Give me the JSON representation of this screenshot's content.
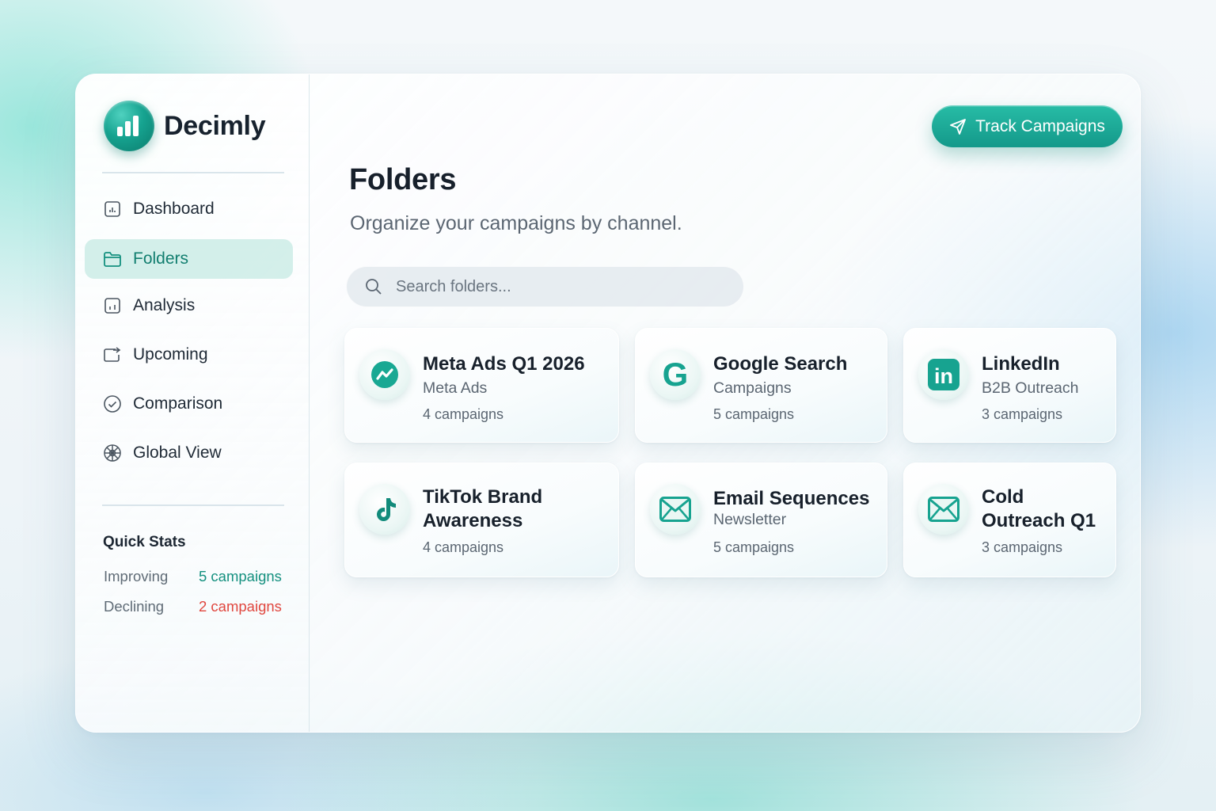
{
  "app": {
    "name": "Decimly",
    "brand_color": "#16a390"
  },
  "sidebar": {
    "items": [
      {
        "label": "Dashboard",
        "icon": "dashboard-icon",
        "active": false
      },
      {
        "label": "Folders",
        "icon": "folder-icon",
        "active": true
      },
      {
        "label": "Analysis",
        "icon": "analysis-icon",
        "active": false
      },
      {
        "label": "Upcoming",
        "icon": "upcoming-icon",
        "active": false
      },
      {
        "label": "Comparison",
        "icon": "check-circle-icon",
        "active": false
      },
      {
        "label": "Global View",
        "icon": "globe-icon",
        "active": false
      }
    ],
    "quick_stats": {
      "title": "Quick Stats",
      "improving_label": "Improving",
      "improving_value": "5 campaigns",
      "improving_color": "#14907f",
      "declining_label": "Declining",
      "declining_value": "2 campaigns",
      "declining_color": "#e0473f"
    }
  },
  "header": {
    "cta_label": "Track Campaigns",
    "cta_icon": "send-icon"
  },
  "main": {
    "title": "Folders",
    "subtitle": "Organize your campaigns by channel.",
    "search_placeholder": "Search folders..."
  },
  "folders": [
    {
      "title": "Meta Ads Q1 2026",
      "subtitle": "Meta Ads",
      "count": "4 campaigns",
      "icon": "meta-trend-icon"
    },
    {
      "title": "Google Search",
      "subtitle": "Campaigns",
      "count": "5 campaigns",
      "icon": "google-icon"
    },
    {
      "title": "LinkedIn",
      "subtitle": "B2B Outreach",
      "count": "3 campaigns",
      "icon": "linkedin-icon"
    },
    {
      "title_line1": "TikTok Brand",
      "title_line2": "Awareness",
      "count": "4 campaigns",
      "icon": "tiktok-icon"
    },
    {
      "title": "Email Sequences",
      "subtitle": "Newsletter",
      "count": "5 campaigns",
      "icon": "email-icon"
    },
    {
      "title_line1": "Cold",
      "title_line2": "Outreach Q1",
      "count": "3 campaigns",
      "icon": "email-icon"
    }
  ]
}
